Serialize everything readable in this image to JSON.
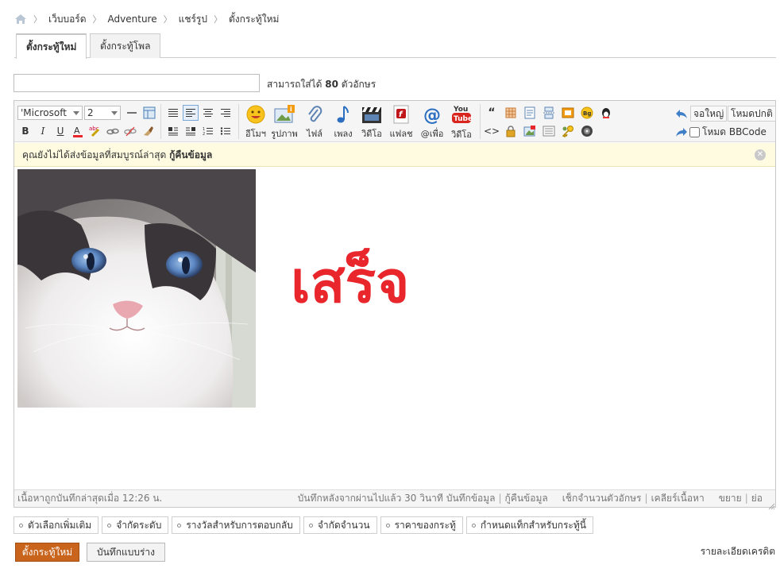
{
  "breadcrumb": {
    "items": [
      "เว็บบอร์ด",
      "Adventure",
      "แชร์รูป",
      "ตั้งกระทู้ใหม่"
    ]
  },
  "tabs": [
    {
      "label": "ตั้งกระทู้ใหม่",
      "active": true
    },
    {
      "label": "ตั้งกระทู้โพล",
      "active": false
    }
  ],
  "title_field": {
    "value": "",
    "hint_prefix": "สามารถใส่ได้",
    "hint_count": "80",
    "hint_suffix": "ตัวอักษร"
  },
  "toolbar": {
    "font_family": "'Microsoft",
    "font_size": "2",
    "big_buttons": [
      "อีโมฯ",
      "รูปภาพ",
      "ไฟล์",
      "เพลง",
      "วิดีโอ",
      "แฟลช",
      "@เพื่อ",
      "วิดีโอ"
    ],
    "fullscreen_label": "จอใหญ่",
    "normal_mode_label": "โหมดปกติ",
    "bbcode_label": "โหมด BBCode"
  },
  "notice": {
    "text": "คุณยังไม่ได้ส่งข้อมูลที่สมบูรณ์ล่าสุด",
    "link": "กู้คืนข้อมูล"
  },
  "content": {
    "big_text": "เสร็จ",
    "big_text_color": "#e8262c"
  },
  "statusbar": {
    "left": "เนื้อหาถูกบันทึกล่าสุดเมื่อ 12:26 น.",
    "autosave": "บันทึกหลังจากผ่านไปแล้ว 30 วินาที",
    "save_data": "บันทึกข้อมูล",
    "restore": "กู้คืนข้อมูล",
    "check_chars": "เช็กจำนวนตัวอักษร",
    "clear": "เคลียร์เนื้อหา",
    "expand": "ขยาย",
    "shrink": "ย่อ"
  },
  "options": [
    "ตัวเลือกเพิ่มเติม",
    "จำกัดระดับ",
    "รางวัลสำหรับการตอบกลับ",
    "จำกัดจำนวน",
    "ราคาของกระทู้",
    "กำหนดแท็กสำหรับกระทู้นี้"
  ],
  "buttons": {
    "submit": "ตั้งกระทู้ใหม่",
    "submit_color": "#c9641c",
    "draft": "บันทึกแบบร่าง"
  },
  "credit_link": "รายละเอียดเครดิต"
}
